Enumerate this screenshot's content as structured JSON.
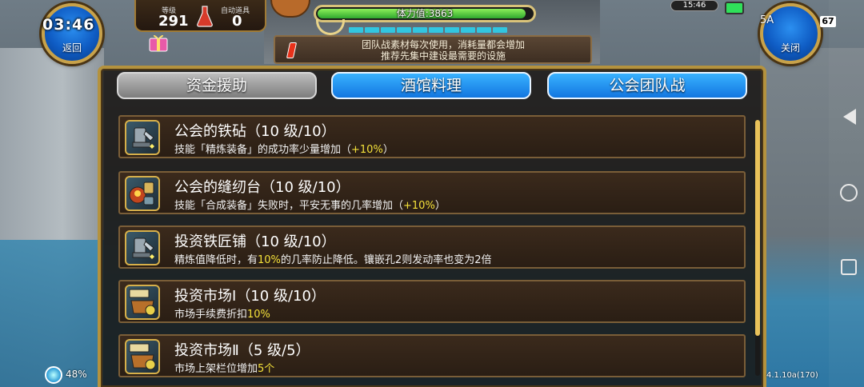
{
  "status_bar": {
    "clock": "03:46",
    "small_time": "15:46",
    "battery": "67",
    "signal_label": "5A"
  },
  "corner_buttons": {
    "back": "返回",
    "close": "关闭"
  },
  "player": {
    "level_label": "等级",
    "level_value": "291",
    "auto_item_label": "自动道具",
    "auto_item_value": "0"
  },
  "stamina": {
    "label": "体力值:3863",
    "fill_fraction": 0.97,
    "segments_filled": 10
  },
  "notice": {
    "line1": "团队战素材每次使用，消耗量都会增加",
    "line2": "推荐先集中建设最需要的设施"
  },
  "tabs": [
    {
      "label": "资金援助",
      "active": false
    },
    {
      "label": "酒馆料理",
      "active": true
    },
    {
      "label": "公会团队战",
      "active": true
    }
  ],
  "facilities": [
    {
      "name": "公会的铁砧",
      "level": "（10 级/10）",
      "desc_pre": "技能「精炼装备」的成功率少量增加（",
      "desc_hl": "+10%",
      "desc_post": "）",
      "icon": "anvil-icon"
    },
    {
      "name": "公会的缝纫台",
      "level": "（10 级/10）",
      "desc_pre": "技能「合成装备」失败时，平安无事的几率增加（",
      "desc_hl": "+10%",
      "desc_post": "）",
      "icon": "sewing-icon"
    },
    {
      "name": "投资铁匠铺",
      "level": "（10 级/10）",
      "desc_pre": "精炼值降低时，有",
      "desc_hl": "10%",
      "desc_post": "的几率防止降低。镶嵌孔2则发动率也变为2倍",
      "icon": "anvil-icon"
    },
    {
      "name": "投资市场Ⅰ",
      "level": "（10 级/10）",
      "desc_pre": "市场手续费折扣",
      "desc_hl": "10%",
      "desc_post": "",
      "icon": "market-icon"
    },
    {
      "name": "投资市场Ⅱ",
      "level": "（5 级/5）",
      "desc_pre": "市场上架栏位增加",
      "desc_hl": "5个",
      "desc_post": "",
      "icon": "market-icon"
    }
  ],
  "footer": {
    "wifi_pct": "48%",
    "version": "4.1.10a(170)"
  },
  "colors": {
    "frame_gold": "#b4923e",
    "tab_active": "#1276e0",
    "highlight": "#f5e23a",
    "stamina_green": "#2fa82e"
  }
}
